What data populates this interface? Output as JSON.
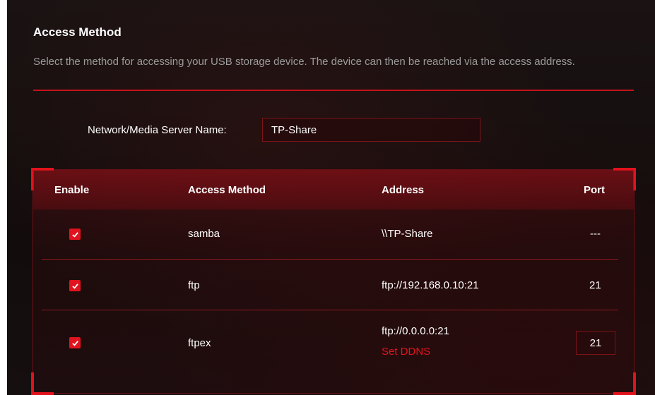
{
  "section": {
    "title": "Access Method",
    "description": "Select the method for accessing your USB storage device. The device can then be reached via the access address."
  },
  "server": {
    "label": "Network/Media Server Name:",
    "value": "TP-Share"
  },
  "table": {
    "headers": {
      "enable": "Enable",
      "method": "Access Method",
      "address": "Address",
      "port": "Port"
    },
    "rows": [
      {
        "enabled": true,
        "method": "samba",
        "address": "\\\\TP-Share",
        "port": "---"
      },
      {
        "enabled": true,
        "method": "ftp",
        "address": "ftp://192.168.0.10:21",
        "port": "21"
      },
      {
        "enabled": true,
        "method": "ftpex",
        "address": "ftp://0.0.0.0:21",
        "link": "Set DDNS",
        "port": "21"
      }
    ]
  },
  "colors": {
    "accent": "#e0141e",
    "background": "#140e0e",
    "muted_text": "#9b9b9b"
  }
}
